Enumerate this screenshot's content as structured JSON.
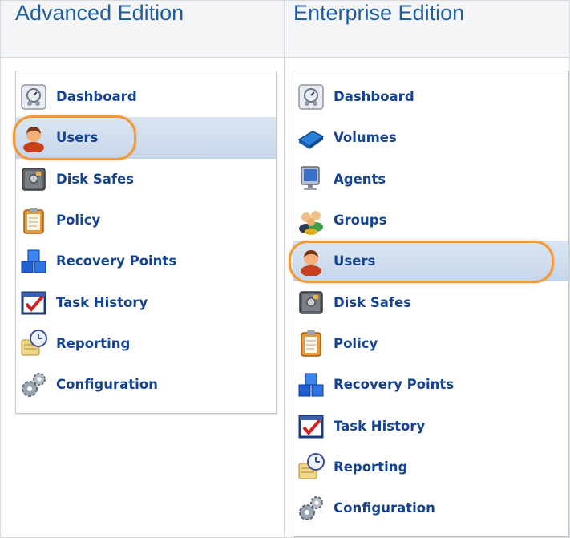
{
  "columns": [
    {
      "title": "Advanced Edition"
    },
    {
      "title": "Enterprise Edition"
    }
  ],
  "advanced_menu": [
    {
      "label": "Dashboard",
      "icon": "dashboard-icon"
    },
    {
      "label": "Users",
      "icon": "user-icon",
      "selected": true,
      "highlighted": true
    },
    {
      "label": "Disk Safes",
      "icon": "safe-icon"
    },
    {
      "label": "Policy",
      "icon": "clipboard-icon"
    },
    {
      "label": "Recovery Points",
      "icon": "cubes-icon"
    },
    {
      "label": "Task History",
      "icon": "task-history-icon"
    },
    {
      "label": "Reporting",
      "icon": "reporting-icon"
    },
    {
      "label": "Configuration",
      "icon": "gears-icon"
    }
  ],
  "enterprise_menu": [
    {
      "label": "Dashboard",
      "icon": "dashboard-icon"
    },
    {
      "label": "Volumes",
      "icon": "volumes-icon"
    },
    {
      "label": "Agents",
      "icon": "monitor-icon"
    },
    {
      "label": "Groups",
      "icon": "group-icon"
    },
    {
      "label": "Users",
      "icon": "user-icon",
      "selected": true,
      "highlighted": true
    },
    {
      "label": "Disk Safes",
      "icon": "safe-icon"
    },
    {
      "label": "Policy",
      "icon": "clipboard-icon"
    },
    {
      "label": "Recovery Points",
      "icon": "cubes-icon"
    },
    {
      "label": "Task History",
      "icon": "task-history-icon"
    },
    {
      "label": "Reporting",
      "icon": "reporting-icon"
    },
    {
      "label": "Configuration",
      "icon": "gears-icon"
    }
  ],
  "colors": {
    "header_text": "#1f5fa0",
    "menu_text": "#15438f",
    "highlight_outline": "#f29a3a",
    "selected_row": "#c6d6ea"
  }
}
